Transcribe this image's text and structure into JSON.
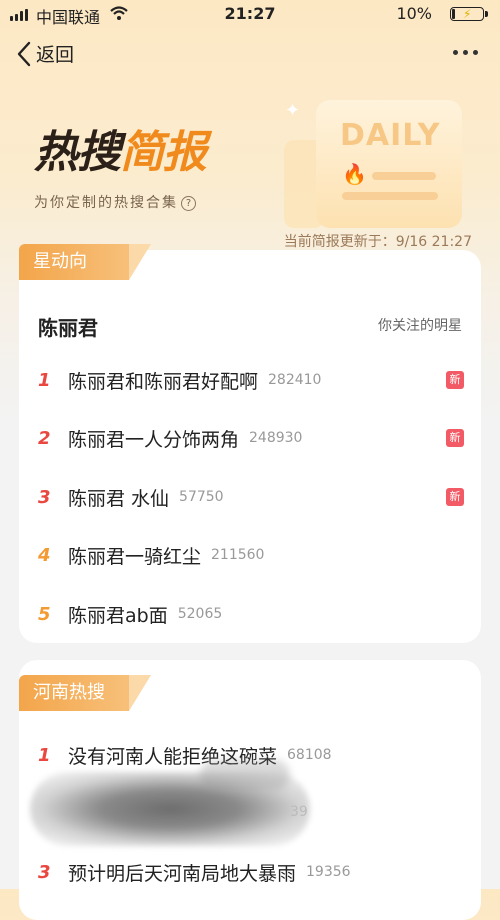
{
  "status_bar": {
    "carrier": "中国联通",
    "time": "21:27",
    "battery": "10%"
  },
  "nav": {
    "back_label": "返回"
  },
  "hero": {
    "title_part1": "热搜",
    "title_part2": "简报",
    "subtitle": "为你定制的热搜合集",
    "daily_label": "DAILY",
    "update_text": "当前简报更新于：9/16 21:27"
  },
  "section1": {
    "tag": "星动向",
    "star_name": "陈丽君",
    "follow_note": "你关注的明星",
    "items": [
      {
        "rank": "1",
        "title": "陈丽君和陈丽君好配啊",
        "count": "282410",
        "badge": "新"
      },
      {
        "rank": "2",
        "title": "陈丽君一人分饰两角",
        "count": "248930",
        "badge": "新"
      },
      {
        "rank": "3",
        "title": "陈丽君 水仙",
        "count": "57750",
        "badge": "新"
      },
      {
        "rank": "4",
        "title": "陈丽君一骑红尘",
        "count": "211560",
        "badge": ""
      },
      {
        "rank": "5",
        "title": "陈丽君ab面",
        "count": "52065",
        "badge": ""
      }
    ]
  },
  "section2": {
    "tag": "河南热搜",
    "items": [
      {
        "rank": "1",
        "title": "没有河南人能拒绝这碗菜",
        "count": "68108"
      },
      {
        "rank": "2",
        "title": "",
        "count": "39"
      },
      {
        "rank": "3",
        "title": "预计明后天河南局地大暴雨",
        "count": "19356"
      }
    ]
  },
  "colors": {
    "accent_orange": "#f08a1c",
    "rank_top": "#e9473f",
    "rank_other": "#f39a32",
    "badge_new": "#f25b66"
  }
}
